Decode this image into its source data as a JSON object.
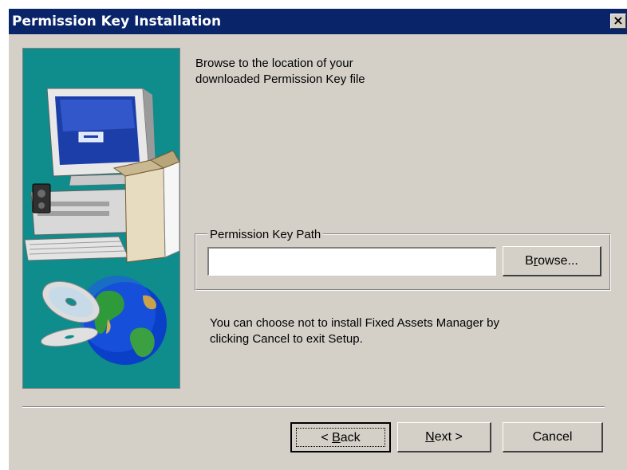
{
  "window": {
    "title": "Permission Key Installation",
    "close_glyph": "×"
  },
  "prompt": {
    "line1": "Browse to the location of your",
    "line2": "downloaded Permission Key file"
  },
  "key_path": {
    "group_label": "Permission Key Path",
    "value": "",
    "browse_label_pre": "B",
    "browse_label_u": "r",
    "browse_label_post": "owse..."
  },
  "info": {
    "line1": "You can choose not to install Fixed Assets Manager by",
    "line2": "clicking Cancel to exit Setup."
  },
  "buttons": {
    "back_pre": "< ",
    "back_u": "B",
    "back_post": "ack",
    "next_u": "N",
    "next_post": "ext >",
    "cancel": "Cancel"
  },
  "icons": [
    "close-icon",
    "computer-icon",
    "software-box-icon",
    "globe-icon",
    "cd-icon"
  ],
  "colors": {
    "titlebar": "#0a246a",
    "dialog": "#d4d0c8",
    "art_background": "#0f8c8c"
  }
}
